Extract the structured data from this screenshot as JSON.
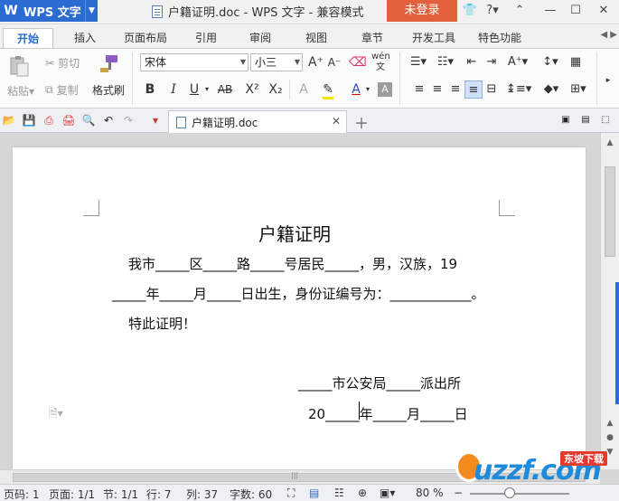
{
  "titlebar": {
    "app_name": "WPS 文字",
    "document_title": "户籍证明.doc - WPS 文字 - 兼容模式",
    "login_label": "未登录",
    "help_label": "?",
    "controls": [
      "shirt-icon",
      "help-icon",
      "collapse-icon",
      "minimize-icon",
      "maximize-icon",
      "close-icon"
    ]
  },
  "tabs": [
    "开始",
    "插入",
    "页面布局",
    "引用",
    "审阅",
    "视图",
    "章节",
    "开发工具",
    "特色功能"
  ],
  "active_tab": "开始",
  "ribbon": {
    "paste_label": "粘贴",
    "cut_label": "剪切",
    "copy_label": "复制",
    "format_painter_label": "格式刷",
    "font_name": "宋体",
    "font_size": "小三",
    "bold": "B",
    "italic": "I",
    "underline": "U",
    "strike": "AB",
    "superscript": "X²",
    "subscript": "X₂",
    "font_color": "A"
  },
  "quick_access": {
    "doc_tab_label": "户籍证明.doc"
  },
  "document": {
    "heading": "户籍证明",
    "line1": "我市_____区_____路_____号居民_____，男，汉族，19",
    "line2": "_____年_____月_____日出生，身份证编号为：____________。",
    "line3": "特此证明！",
    "line4": "_____市公安局_____派出所",
    "line5": "20_____年_____月_____日"
  },
  "statusbar": {
    "page_code": "页码: 1",
    "page": "页面: 1/1",
    "section": "节: 1/1",
    "row": "行: 7",
    "column": "列: 37",
    "word_count": "字数: 60",
    "zoom": "80 %",
    "zoom_level": 0.4
  },
  "watermark": {
    "brand": "uzzf.com",
    "tag": "东坡下载"
  }
}
